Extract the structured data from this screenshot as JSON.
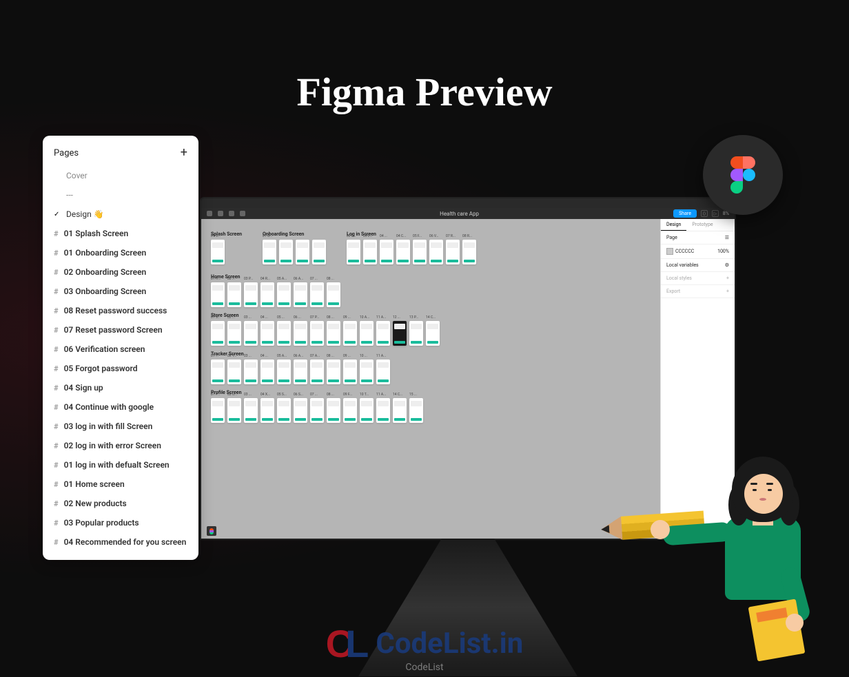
{
  "title": "Figma Preview",
  "pages_panel": {
    "header": "Pages",
    "items": [
      {
        "label": "Cover",
        "type": "plain",
        "muted": true
      },
      {
        "label": "---",
        "type": "plain",
        "muted": true
      },
      {
        "label": "Design 👋",
        "type": "checked"
      },
      {
        "label": "01 Splash Screen",
        "type": "frame",
        "bold": true
      },
      {
        "label": "01 Onboarding Screen",
        "type": "frame",
        "bold": true
      },
      {
        "label": "02 Onboarding Screen",
        "type": "frame",
        "bold": true
      },
      {
        "label": "03 Onboarding Screen",
        "type": "frame",
        "bold": true
      },
      {
        "label": "08 Reset password success",
        "type": "frame",
        "bold": true
      },
      {
        "label": "07 Reset password Screen",
        "type": "frame",
        "bold": true
      },
      {
        "label": "06 Verification screen",
        "type": "frame",
        "bold": true
      },
      {
        "label": "05 Forgot password",
        "type": "frame",
        "bold": true
      },
      {
        "label": "04 Sign up",
        "type": "frame",
        "bold": true
      },
      {
        "label": "04 Continue with google",
        "type": "frame",
        "bold": true
      },
      {
        "label": "03 log in with fill Screen",
        "type": "frame",
        "bold": true
      },
      {
        "label": "02 log in with error Screen",
        "type": "frame",
        "bold": true
      },
      {
        "label": "01 log in with defualt Screen",
        "type": "frame",
        "bold": true
      },
      {
        "label": "01 Home screen",
        "type": "frame",
        "bold": true
      },
      {
        "label": "02 New products",
        "type": "frame",
        "bold": true
      },
      {
        "label": "03 Popular products",
        "type": "frame",
        "bold": true
      },
      {
        "label": "04 Recommended for you screen",
        "type": "frame",
        "bold": true
      }
    ]
  },
  "figma_window": {
    "doc_title": "Health care App",
    "share_label": "Share",
    "zoom": "8%",
    "right_panel": {
      "tabs": [
        "Design",
        "Prototype"
      ],
      "page_label": "Page",
      "bg_hex": "CCCCCC",
      "bg_pct": "100%",
      "local_vars": "Local variables",
      "local_styles": "Local styles",
      "export": "Export"
    },
    "sections": [
      {
        "name": "Splash Screen",
        "frames": [
          "01 S..."
        ]
      },
      {
        "name": "Onboarding Screen",
        "frames": [
          "01 O...",
          "",
          "",
          ""
        ]
      },
      {
        "name": "Log in Screen",
        "frames": [
          "02 L...",
          "03 L...",
          "04 ...",
          "04 C...",
          "05 F...",
          "06 V...",
          "07 R...",
          "08 R..."
        ]
      },
      {
        "name": "Home Screen",
        "frames": [
          "01 H...",
          "02 ...",
          "03 P...",
          "04 R...",
          "05 A...",
          "06 A...",
          "07 ...",
          "08 ..."
        ]
      },
      {
        "name": "Store Screen",
        "frames": [
          "01 S...",
          "02 ...",
          "03 ...",
          "04 ...",
          "05 ...",
          "06 ...",
          "07 P...",
          "08 ...",
          "09 ...",
          "10 A...",
          "11 A...",
          "12 ...",
          "13 P...",
          "14 C..."
        ]
      },
      {
        "name": "Tracker Screen",
        "frames": [
          "01 ...",
          "02 T...",
          "03 ...",
          "04 ...",
          "05 A...",
          "06 A...",
          "07 A...",
          "08 ...",
          "09 ...",
          "10 ...",
          "11 A..."
        ]
      },
      {
        "name": "Profile Screen",
        "frames": [
          "01 P...",
          "02 U...",
          "03 ...",
          "04 X...",
          "05 S...",
          "06 S...",
          "07 ...",
          "08 ...",
          "09 F...",
          "10 T...",
          "11 A...",
          "14 C...",
          "15 ..."
        ]
      }
    ]
  },
  "watermark": {
    "brand": "CodeList",
    "suffix": ".in",
    "sub": "CodeList"
  }
}
